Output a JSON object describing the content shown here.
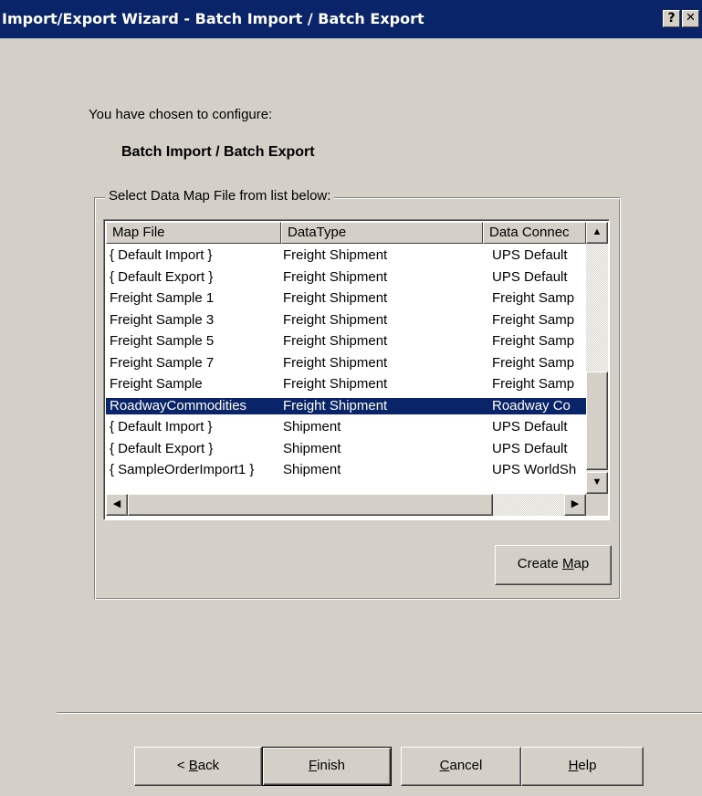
{
  "window": {
    "title": "Import/Export Wizard - Batch Import / Batch Export",
    "help_button": "?",
    "close_button": "✕"
  },
  "intro": {
    "text": "You have chosen to configure:",
    "selection": "Batch Import / Batch Export"
  },
  "group": {
    "label": "Select Data Map File from list below:"
  },
  "list": {
    "columns": [
      "Map File",
      "DataType",
      "Data Connec"
    ],
    "rows": [
      {
        "map": "{ Default Import }",
        "type": "Freight Shipment",
        "conn": "UPS Default"
      },
      {
        "map": "{ Default Export }",
        "type": "Freight Shipment",
        "conn": "UPS Default"
      },
      {
        "map": "Freight Sample 1",
        "type": "Freight Shipment",
        "conn": "Freight Samp"
      },
      {
        "map": "Freight Sample 3",
        "type": "Freight Shipment",
        "conn": "Freight Samp"
      },
      {
        "map": "Freight Sample 5",
        "type": "Freight Shipment",
        "conn": "Freight Samp"
      },
      {
        "map": "Freight Sample 7",
        "type": "Freight Shipment",
        "conn": "Freight Samp"
      },
      {
        "map": "Freight Sample",
        "type": "Freight Shipment",
        "conn": "Freight Samp"
      },
      {
        "map": "RoadwayCommodities",
        "type": "Freight Shipment",
        "conn": "Roadway Co"
      },
      {
        "map": "{ Default Import }",
        "type": "Shipment",
        "conn": "UPS Default"
      },
      {
        "map": "{ Default Export }",
        "type": "Shipment",
        "conn": "UPS Default"
      },
      {
        "map": "{ SampleOrderImport1 }",
        "type": "Shipment",
        "conn": "UPS WorldSh"
      }
    ],
    "selected_index": 7
  },
  "buttons": {
    "create_map": {
      "pre": "Create ",
      "key": "M",
      "post": "ap"
    },
    "back": {
      "pre": "< ",
      "key": "B",
      "post": "ack"
    },
    "finish": {
      "pre": "",
      "key": "F",
      "post": "inish"
    },
    "cancel": {
      "pre": "",
      "key": "C",
      "post": "ancel"
    },
    "help": {
      "pre": "",
      "key": "H",
      "post": "elp"
    }
  },
  "colors": {
    "titlebar": "#0a246a",
    "face": "#d4d0c8",
    "selection": "#0a246a"
  }
}
